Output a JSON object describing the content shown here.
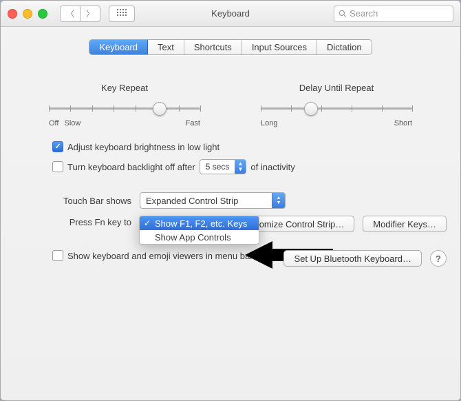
{
  "window": {
    "title": "Keyboard"
  },
  "search": {
    "placeholder": "Search"
  },
  "tabs": [
    "Keyboard",
    "Text",
    "Shortcuts",
    "Input Sources",
    "Dictation"
  ],
  "sliders": {
    "key_repeat": {
      "title": "Key Repeat",
      "left1": "Off",
      "left2": "Slow",
      "right": "Fast",
      "ticks": 8,
      "pos_pct": 73
    },
    "delay": {
      "title": "Delay Until Repeat",
      "left": "Long",
      "right": "Short",
      "ticks": 6,
      "pos_pct": 33
    }
  },
  "rows": {
    "adjust_brightness": "Adjust keyboard brightness in low light",
    "backlight_off_prefix": "Turn keyboard backlight off after",
    "backlight_off_value": "5 secs",
    "backlight_off_suffix": "of inactivity",
    "touchbar_label": "Touch Bar shows",
    "touchbar_value": "Expanded Control Strip",
    "fn_label": "Press Fn key to",
    "show_viewers": "Show keyboard and emoji viewers in menu bar"
  },
  "dropdown": {
    "items": [
      "Show F1, F2, etc. Keys",
      "Show App Controls"
    ],
    "selected_index": 0
  },
  "buttons": {
    "customize": "Customize Control Strip…",
    "modifier": "Modifier Keys…",
    "bluetooth": "Set Up Bluetooth Keyboard…"
  }
}
